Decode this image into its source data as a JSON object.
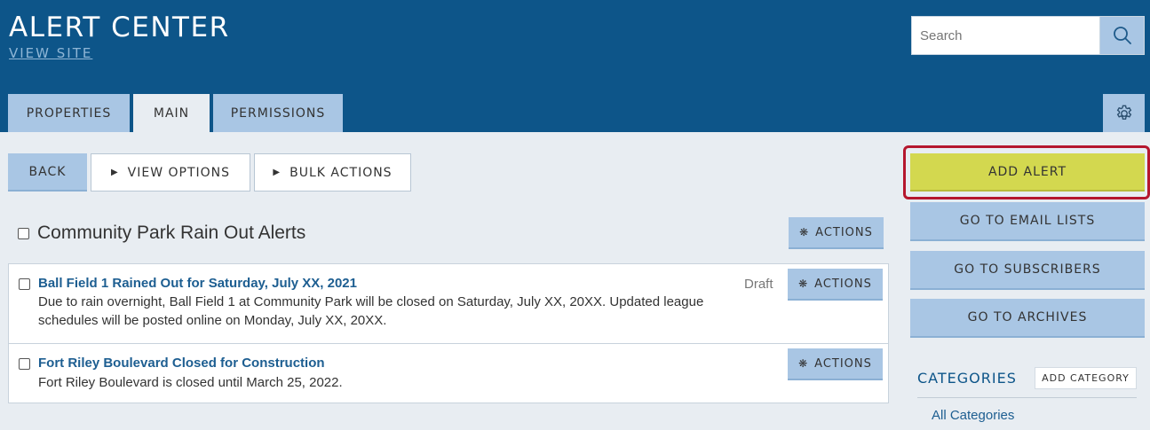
{
  "header": {
    "title": "ALERT CENTER",
    "view_site": "VIEW SITE",
    "search_placeholder": "Search"
  },
  "tabs": [
    {
      "label": "PROPERTIES",
      "active": false
    },
    {
      "label": "MAIN",
      "active": true
    },
    {
      "label": "PERMISSIONS",
      "active": false
    }
  ],
  "toolbar": {
    "back": "BACK",
    "view_options": "VIEW OPTIONS",
    "bulk_actions": "BULK ACTIONS"
  },
  "sidebar": {
    "add_alert": "ADD ALERT",
    "go_to_email_lists": "GO TO EMAIL LISTS",
    "go_to_subscribers": "GO TO SUBSCRIBERS",
    "go_to_archives": "GO TO ARCHIVES",
    "categories_label": "CATEGORIES",
    "add_category": "ADD CATEGORY",
    "all_categories": "All Categories"
  },
  "list": {
    "title": "Community Park Rain Out Alerts",
    "actions_label": "ACTIONS",
    "alerts": [
      {
        "title": "Ball Field 1 Rained Out for Saturday, July XX, 2021",
        "body_line1": "Due to rain overnight, Ball Field 1 at Community Park will be closed on Saturday, July XX, 20XX. Updated league",
        "body_line2": "schedules will be posted online on Monday, July XX, 20XX.",
        "status": "Draft",
        "actions_label": "ACTIONS"
      },
      {
        "title": "Fort Riley Boulevard Closed for Construction",
        "body_line1": "Fort Riley Boulevard is closed until March 25, 2022.",
        "status": "",
        "actions_label": "ACTIONS"
      }
    ]
  },
  "colors": {
    "header_bg": "#0d5589",
    "tab_bg": "#a9c6e4",
    "add_alert_bg": "#d3d84f",
    "highlight_border": "#b5172e",
    "link": "#1d5e91"
  }
}
